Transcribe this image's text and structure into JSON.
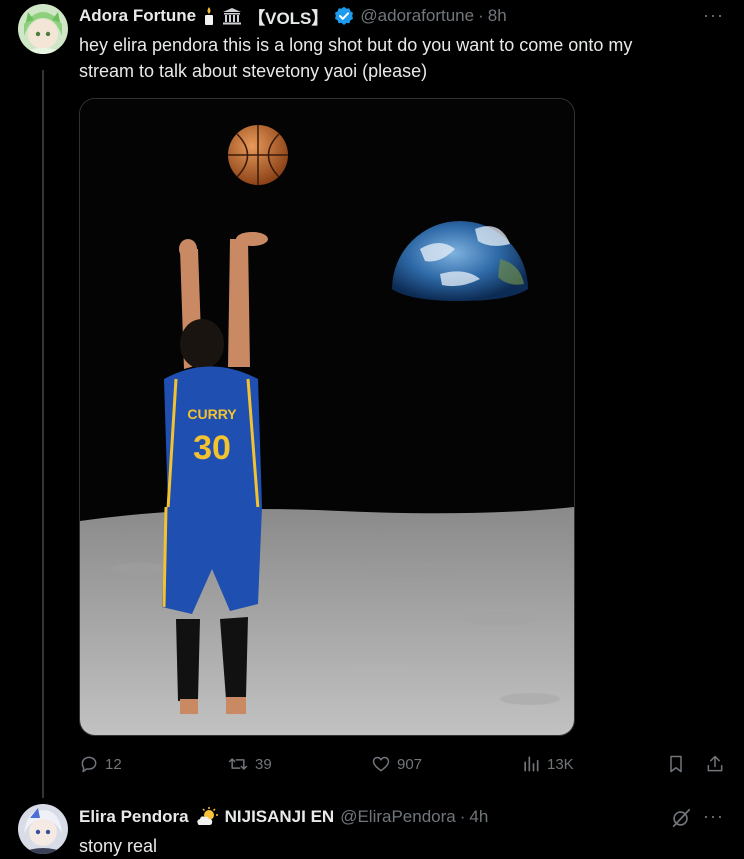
{
  "tweet1": {
    "display_name": "Adora Fortune",
    "tag": "【VOLS】",
    "handle": "@adorafortune",
    "time": "8h",
    "text_line1": "hey elira pendora this is a long shot but do you want to come onto my",
    "text_line2": "stream to talk about stevetony yaoi (please)",
    "jersey_name": "CURRY",
    "jersey_number": "30",
    "counts": {
      "replies": "12",
      "retweets": "39",
      "likes": "907",
      "views": "13K"
    },
    "more_label": "···"
  },
  "tweet2": {
    "display_name": "Elira Pendora",
    "tag": "NIJISANJI EN",
    "handle": "@EliraPendora",
    "time": "4h",
    "text": "stony real",
    "more_label": "···"
  },
  "icons": {
    "verified": "verified-badge-icon",
    "candle": "candle-emoji-icon",
    "bank": "classical-building-emoji-icon",
    "sun_cloud": "sun-behind-cloud-emoji-icon",
    "reply": "reply-icon",
    "retweet": "retweet-icon",
    "like": "heart-icon",
    "views": "views-chart-icon",
    "bookmark": "bookmark-icon",
    "share": "share-icon",
    "grok": "grok-icon"
  },
  "colors": {
    "background": "#000000",
    "text": "#e7e9ea",
    "muted": "#71767b",
    "verified": "#1d9bf0"
  }
}
